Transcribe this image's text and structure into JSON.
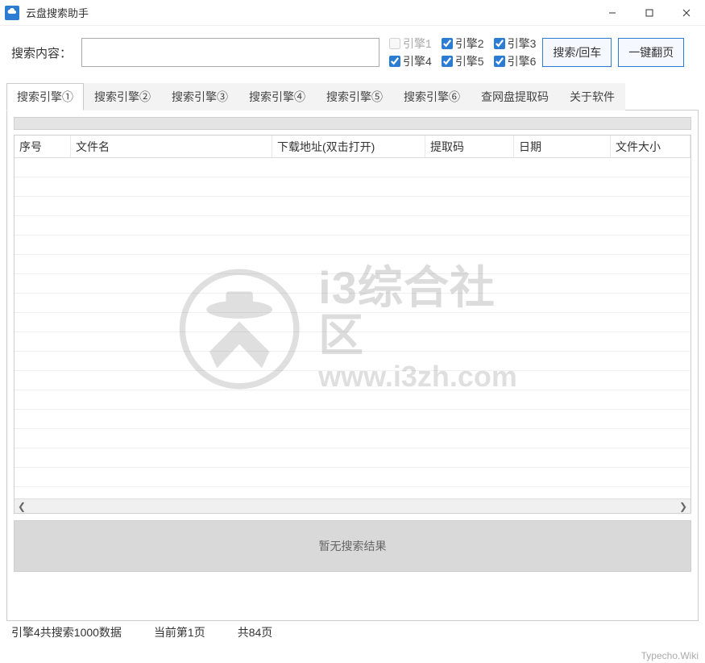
{
  "titlebar": {
    "title": "云盘搜索助手"
  },
  "search": {
    "label": "搜索内容：",
    "value": "",
    "placeholder": ""
  },
  "engines": {
    "e1": {
      "label": "引擎1",
      "checked": false,
      "disabled": true
    },
    "e2": {
      "label": "引擎2",
      "checked": true
    },
    "e3": {
      "label": "引擎3",
      "checked": true
    },
    "e4": {
      "label": "引擎4",
      "checked": true
    },
    "e5": {
      "label": "引擎5",
      "checked": true
    },
    "e6": {
      "label": "引擎6",
      "checked": true
    }
  },
  "buttons": {
    "search": "搜索/回车",
    "page": "一键翻页"
  },
  "tabs": [
    {
      "label": "搜索引擎①",
      "active": true
    },
    {
      "label": "搜索引擎②"
    },
    {
      "label": "搜索引擎③"
    },
    {
      "label": "搜索引擎④"
    },
    {
      "label": "搜索引擎⑤"
    },
    {
      "label": "搜索引擎⑥"
    },
    {
      "label": "查网盘提取码"
    },
    {
      "label": "关于软件"
    }
  ],
  "columns": {
    "c1": "序号",
    "c2": "文件名",
    "c3": "下载地址(双击打开)",
    "c4": "提取码",
    "c5": "日期",
    "c6": "文件大小"
  },
  "watermark": {
    "text": "i3综合社区",
    "url": "www.i3zh.com"
  },
  "no_result": "暂无搜索结果",
  "status": {
    "s1": "引擎4共搜索1000数据",
    "s2": "当前第1页",
    "s3": "共84页"
  },
  "corner": "Typecho.Wiki"
}
